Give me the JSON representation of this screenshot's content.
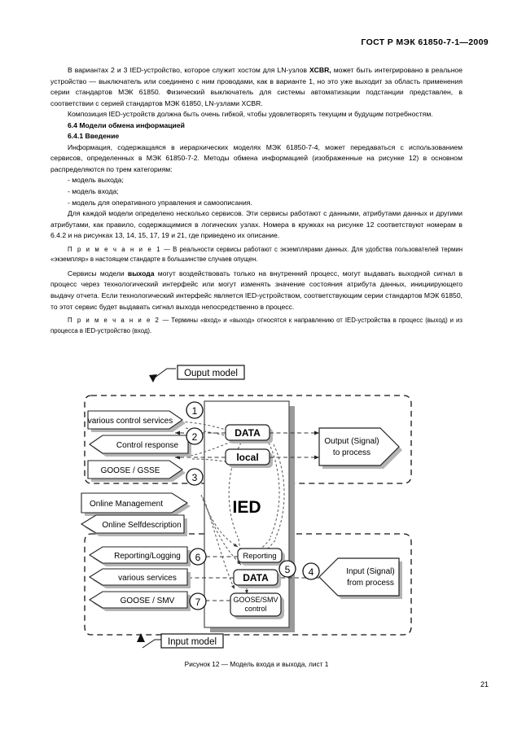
{
  "header": {
    "standard": "ГОСТ Р МЭК 61850-7-1—2009"
  },
  "body": {
    "p1": "В вариантах 2 и 3 IED-устройство, которое служит хостом для LN-узлов ",
    "p1_bold": "XCBR,",
    "p1_rest": " может быть интегрировано в реальное устройство — выключатель или соединено с ним проводами, как в варианте 1, но это уже выходит за область применения серии стандартов МЭК 61850. Физический выключатель для системы автоматизации подстанции представлен, в соответствии с серией стандартов МЭК 61850, LN-узлами XCBR.",
    "p2": "Композиция IED-устройств должна быть очень гибкой, чтобы удовлетворять текущим и будущим потребностям.",
    "h_64": "6.4 Модели обмена информацией",
    "h_641": "6.4.1 Введение",
    "p3": "Информация, содержащаяся в иерархических моделях МЭК 61850-7-4, может передаваться с использованием сервисов, определенных в МЭК 61850-7-2. Методы обмена информацией (изображенные на рисунке 12) в основном распределяются по трем категориям:",
    "bullet1": "- модель выхода;",
    "bullet2": "- модель входа;",
    "bullet3": "- модель для оперативного управления и самоописания.",
    "p4": "Для каждой модели определено несколько сервисов. Эти сервисы работают с данными, атрибутами данных и другими атрибутами, как правило, содержащимися в логических узлах. Номера в кружках на рисунке 12  соответствуют  номерам в 6.4.2 и на рисунках 13, 14, 15, 17, 19 и 21, где приведено их описание.",
    "note1_label": "П р и м е ч а н и е 1",
    "note1_text": " — В реальности сервисы работают с экземплярами данных. Для удобства пользователей термин «экземпляр» в настоящем стандарте в большинстве случаев опущен.",
    "p5_a": "Сервисы модели ",
    "p5_bold": "выхода",
    "p5_b": " могут воздействовать только на внутренний процесс, могут выдавать выходной сигнал в процесс через технологический интерфейс или могут изменять значение состояния атрибута данных, инициирующего выдачу отчета. Если технологический интерфейс является IED-устройством, соответствующим серии стандартов МЭК 61850, то этот сервис будет выдавать сигнал выхода непосредственно в процесс.",
    "note2_label": "П р и м е ч а н и е 2",
    "note2_text": " — Термины «вход» и «выход» относятся к направлению от IED-устройства в процесс (выход) и из процесса в IED-устройство (вход)."
  },
  "figure": {
    "output_model_label": "Ouput model",
    "input_model_label": "Input model",
    "ied_label": "IED",
    "output_blocks": {
      "data": "DATA",
      "local": "local"
    },
    "input_blocks": {
      "reporting": "Reporting",
      "data": "DATA",
      "goose_smv_control_line1": "GOOSE/SMV",
      "goose_smv_control_line2": "control"
    },
    "left_output_services": [
      {
        "label": "various control services",
        "marker": "1",
        "shape": "right-arrow"
      },
      {
        "label": "Control response",
        "marker": "2",
        "shape": "left-arrow"
      },
      {
        "label": "GOOSE / GSSE",
        "marker": "3",
        "shape": "right-arrow"
      }
    ],
    "left_middle_services": [
      {
        "label": "Online Management",
        "shape": "right-arrow"
      },
      {
        "label": "Online Selfdescription",
        "shape": "left-arrow"
      }
    ],
    "left_input_services": [
      {
        "label": "Reporting/Logging",
        "marker": "6",
        "shape": "left-arrow"
      },
      {
        "label": "various services",
        "marker": "5",
        "shape": "left-arrow"
      },
      {
        "label": "GOOSE / SMV",
        "marker": "7",
        "shape": "left-arrow"
      }
    ],
    "right_output": {
      "line1": "Output (Signal)",
      "line2": "to process"
    },
    "right_input": {
      "line1": "Input (Signal)",
      "line2": "from process",
      "marker": "4"
    }
  },
  "caption": "Рисунок 12 — Модель входа и выхода, лист 1",
  "page_number": "21"
}
